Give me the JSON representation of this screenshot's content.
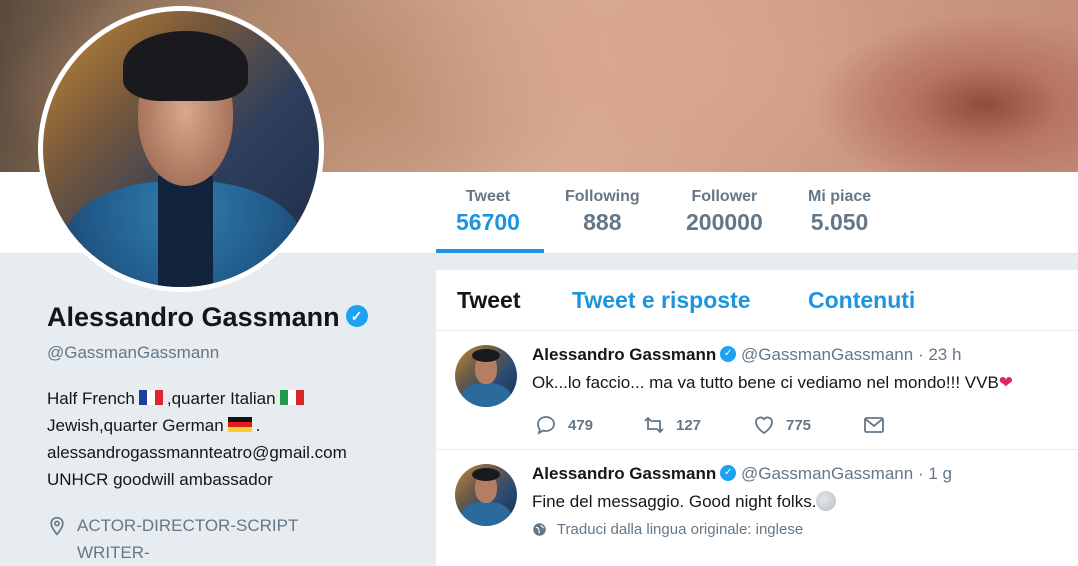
{
  "stats": [
    {
      "label": "Tweet",
      "value": "56700"
    },
    {
      "label": "Following",
      "value": "888"
    },
    {
      "label": "Follower",
      "value": "200000"
    },
    {
      "label": "Mi piace",
      "value": "5.050"
    }
  ],
  "profile": {
    "name": "Alessandro Gassmann",
    "handle": "@GassmanGassmann",
    "bio": {
      "line1_a": "Half French",
      "line1_b": ",quarter Italian",
      "line2_a": "Jewish,quarter German",
      "line2_b": ".",
      "line3": "alessandrogassmannteatro@gmail.com",
      "line4": "UNHCR goodwill ambassador"
    },
    "location": "ACTOR-DIRECTOR-SCRIPT WRITER-"
  },
  "tabs": [
    "Tweet",
    "Tweet e risposte",
    "Contenuti"
  ],
  "tweets": [
    {
      "name": "Alessandro Gassmann",
      "handle": "@GassmanGassmann",
      "sep": "·",
      "time": "23 h",
      "text": "Ok...lo faccio... ma va tutto bene ci vediamo nel mondo!!! VVB",
      "replies": "479",
      "retweets": "127",
      "likes": "775"
    },
    {
      "name": "Alessandro Gassmann",
      "handle": "@GassmanGassmann",
      "sep": "·",
      "time": "1 g",
      "text": "Fine del messaggio. Good night folks.",
      "translate": "Traduci dalla lingua originale: inglese"
    }
  ],
  "colors": {
    "accent": "#1b95e0",
    "verified": "#1da1f2",
    "muted": "#657786",
    "heart": "#e0245e"
  }
}
